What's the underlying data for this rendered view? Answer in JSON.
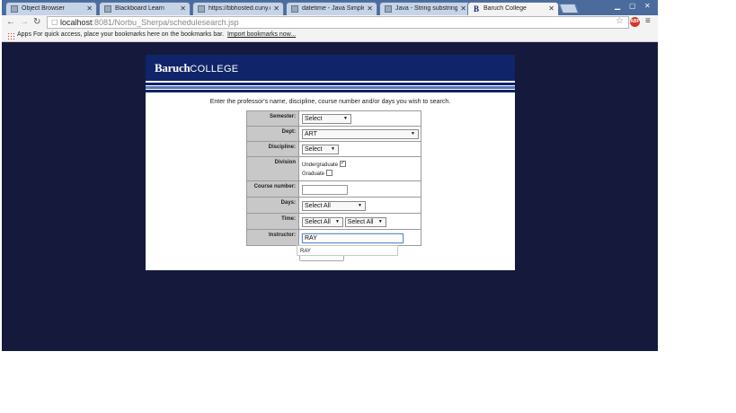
{
  "browser": {
    "tabs": [
      {
        "title": "Object Browser",
        "favicon": "page-icon"
      },
      {
        "title": "Blackboard Learn",
        "favicon": "blackboard-icon"
      },
      {
        "title": "https://bbhosted.cuny.edu",
        "favicon": "page-icon"
      },
      {
        "title": "datetime - Java Simple Da",
        "favicon": "stack-icon"
      },
      {
        "title": "Java - String substring() M",
        "favicon": "page-icon"
      },
      {
        "title": "Baruch College",
        "favicon": "baruch-b-icon"
      }
    ],
    "address": {
      "host": "localhost",
      "path": ":8081/Norbu_Sherpa/schedulesearch.jsp"
    },
    "abp_label": "ABP",
    "bookmarks": {
      "apps": "Apps",
      "hint": "For quick access, place your bookmarks here on the bookmarks bar.",
      "import": "Import bookmarks now..."
    }
  },
  "page": {
    "logo_main": "Baruch",
    "logo_sub": "COLLEGE",
    "intro": "Enter the professor's name, discipline, course number and/or days you wish to search.",
    "form": {
      "semester": {
        "label": "Semester:",
        "value": "Select"
      },
      "dept": {
        "label": "Dept:",
        "value": "ART"
      },
      "discipline": {
        "label": "Discipline:",
        "value": "Select"
      },
      "division": {
        "label": "Division",
        "options": [
          {
            "label": "Undergraduate",
            "checked": true
          },
          {
            "label": "Graduate",
            "checked": false
          }
        ]
      },
      "course_number": {
        "label": "Course number:",
        "value": ""
      },
      "days": {
        "label": "Days:",
        "value": "Select All"
      },
      "time": {
        "label": "Time:",
        "from": "Select All",
        "to": "Select All"
      },
      "instructor": {
        "label": "Instructor:",
        "value": "RAY"
      },
      "autocomplete": [
        "RAY"
      ]
    }
  }
}
